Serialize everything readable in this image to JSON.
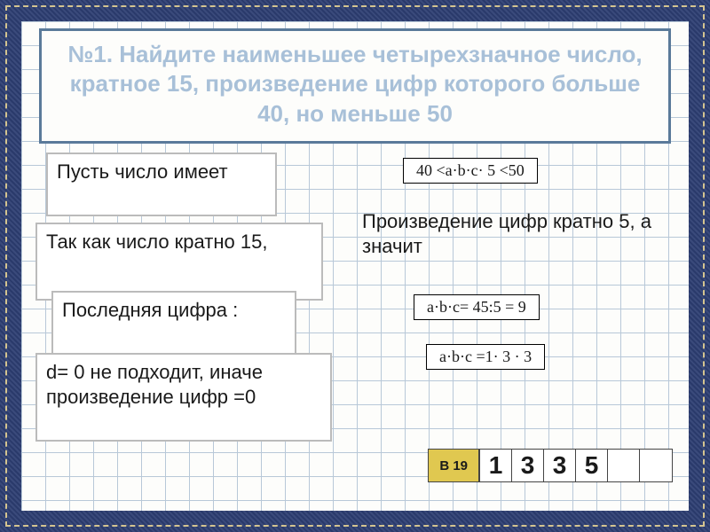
{
  "title": "№1. Найдите наименьшее четырехзначное число, кратное 15, произведение цифр которого больше 40, но меньше 50",
  "boxes": {
    "b1": "Пусть число имеет",
    "b2": "Так как  число кратно 15,",
    "b3": "Последняя цифра :",
    "b4": "d= 0  не подходит, иначе произведение цифр =0"
  },
  "right": "Произведение цифр кратно 5, а значит",
  "formulas": {
    "f1": "40 <a·b·c· 5 <50",
    "f2": "a·b·c= 45:5 = 9",
    "f3": "a·b·c =1· 3 · 3"
  },
  "nav": {
    "label": "В 19",
    "cells": [
      "1",
      "3",
      "3",
      "5",
      "",
      ""
    ]
  }
}
